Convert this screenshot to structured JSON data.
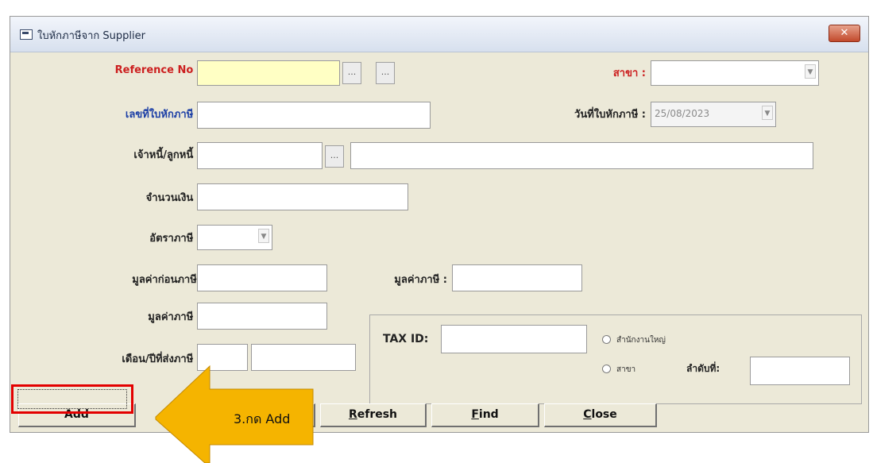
{
  "window": {
    "title": "ใบหักภาษีจาก Supplier",
    "close_label": "✕"
  },
  "form": {
    "reference_label": "Reference No :",
    "reference_value": "",
    "branch_label": "สาขา :",
    "branch_value": "",
    "taxdoc_label": "เลขที่ใบหักภาษี :",
    "taxdoc_value": "",
    "taxdate_label": "วันที่ใบหักภาษี :",
    "taxdate_value": "25/08/2023",
    "creditor_label": "เจ้าหนี้/ลูกหนี้ :",
    "amount_label": "จำนวนเงิน :",
    "taxrate_label": "อัตราภาษี :",
    "pretax_label": "มูลค่าก่อนภาษี:",
    "taxvalue_label_right": "มูลค่าภาษี :",
    "taxvalue_label": "มูลค่าภาษี :",
    "month_year_label": "เดือน/ปีที่ส่งภาษี :",
    "taxid_label": "TAX ID:",
    "head_office_label": "สำนักงานใหญ่",
    "branch_radio_label": "สาขา",
    "sequence_label": "ลำดับที่:"
  },
  "buttons": {
    "add": "Add",
    "refresh_first": "R",
    "refresh_rest": "efresh",
    "find_first": "F",
    "find_rest": "ind",
    "close_first": "C",
    "close_rest": "lose"
  },
  "annotation": {
    "text": "3.กด Add",
    "color": "#f5b400"
  }
}
